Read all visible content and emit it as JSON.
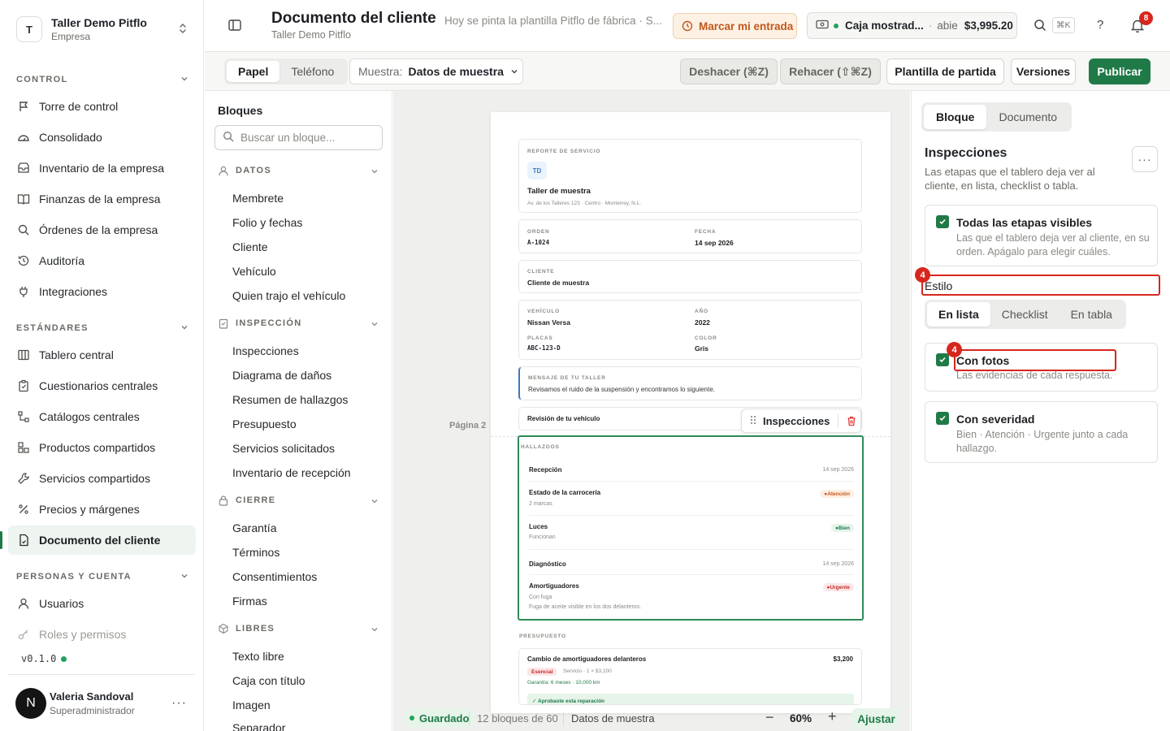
{
  "workspace": {
    "initial": "T",
    "name": "Taller Demo Pitflo",
    "role": "Empresa"
  },
  "nav": {
    "sections": [
      {
        "title": "CONTROL",
        "items": [
          {
            "label": "Torre de control",
            "icon": "tower-icon"
          },
          {
            "label": "Consolidado",
            "icon": "gauge-icon"
          },
          {
            "label": "Inventario de la empresa",
            "icon": "box-icon"
          },
          {
            "label": "Finanzas de la empresa",
            "icon": "book-icon"
          },
          {
            "label": "Órdenes de la empresa",
            "icon": "search-icon"
          },
          {
            "label": "Auditoría",
            "icon": "history-icon"
          },
          {
            "label": "Integraciones",
            "icon": "plug-icon"
          }
        ]
      },
      {
        "title": "ESTÁNDARES",
        "items": [
          {
            "label": "Tablero central",
            "icon": "board-icon"
          },
          {
            "label": "Cuestionarios centrales",
            "icon": "clipboard-icon"
          },
          {
            "label": "Catálogos centrales",
            "icon": "tree-icon"
          },
          {
            "label": "Productos compartidos",
            "icon": "products-icon"
          },
          {
            "label": "Servicios compartidos",
            "icon": "wrench-icon"
          },
          {
            "label": "Precios y márgenes",
            "icon": "percent-icon"
          },
          {
            "label": "Documento del cliente",
            "icon": "document-icon"
          }
        ]
      },
      {
        "title": "PERSONAS Y CUENTA",
        "items": [
          {
            "label": "Usuarios",
            "icon": "user-icon"
          },
          {
            "label": "Roles y permisos",
            "icon": "key-icon"
          }
        ]
      }
    ],
    "active": "Documento del cliente"
  },
  "version": "v0.1.0",
  "user": {
    "initial": "N",
    "name": "Valeria Sandoval",
    "role": "Superadministrador"
  },
  "header": {
    "title": "Documento del cliente",
    "description": "Hoy se pinta la plantilla Pitflo de fábrica · S...",
    "crumb": "Taller Demo Pitflo",
    "clock_in": "Marcar mi entrada",
    "cashbox": {
      "name": "Caja mostrad...",
      "status": "abie",
      "amount": "$3,995.20"
    },
    "shortcut": "⌘K",
    "help": "?",
    "notifications": "8"
  },
  "toolbar": {
    "views": [
      "Papel",
      "Teléfono"
    ],
    "active_view": "Papel",
    "sample_label": "Muestra:",
    "sample_value": "Datos de muestra",
    "undo": "Deshacer (⌘Z)",
    "redo": "Rehacer (⇧⌘Z)",
    "template": "Plantilla de partida",
    "versions": "Versiones",
    "publish": "Publicar"
  },
  "blocks": {
    "title": "Bloques",
    "search_placeholder": "Buscar un bloque...",
    "groups": [
      {
        "title": "DATOS",
        "icon": "person-icon",
        "items": [
          "Membrete",
          "Folio y fechas",
          "Cliente",
          "Vehículo",
          "Quien trajo el vehículo"
        ]
      },
      {
        "title": "INSPECCIÓN",
        "icon": "clipboard-icon",
        "items": [
          "Inspecciones",
          "Diagrama de daños",
          "Resumen de hallazgos",
          "Presupuesto",
          "Servicios solicitados",
          "Inventario de recepción"
        ]
      },
      {
        "title": "CIERRE",
        "icon": "lock-icon",
        "items": [
          "Garantía",
          "Términos",
          "Consentimientos",
          "Firmas"
        ]
      },
      {
        "title": "LIBRES",
        "icon": "cube-icon",
        "items": [
          "Texto libre",
          "Caja con título",
          "Imagen",
          "Separador"
        ]
      }
    ]
  },
  "document": {
    "header_label": "REPORTE DE SERVICIO",
    "logo_initials": "TD",
    "shop_name": "Taller de muestra",
    "shop_address": "Av. de los Talleres 123 · Centro · Monterrey, N.L.",
    "order_label": "ORDEN",
    "order": "A-1024",
    "date_label": "FECHA",
    "date": "14 sep 2026",
    "client_label": "CLIENTE",
    "client": "Cliente de muestra",
    "vehicle_label": "VEHÍCULO",
    "vehicle": "Nissan Versa",
    "year_label": "AÑO",
    "year": "2022",
    "plates_label": "PLACAS",
    "plates": "ABC-123-D",
    "color_label": "COLOR",
    "color": "Gris",
    "message_label": "MENSAJE DE TU TALLER",
    "message": "Revisamos el ruido de la suspensión y encontramos lo siguiente.",
    "review_title": "Revisión de tu vehículo",
    "page_label": "Página 2",
    "floating_label": "Inspecciones",
    "findings_label": "HALLAZGOS",
    "findings": [
      {
        "title": "Recepción",
        "sub": "",
        "date": "14 sep 2026",
        "badge": ""
      },
      {
        "title": "Estado de la carrocería",
        "sub": "2 marcas",
        "date": "",
        "badge": "Atención"
      },
      {
        "title": "Luces",
        "sub": "Funcionan",
        "date": "",
        "badge": "Bien"
      },
      {
        "title": "Diagnóstico",
        "sub": "",
        "date": "14 sep 2026",
        "badge": ""
      },
      {
        "title": "Amortiguadores",
        "sub": "Con fuga",
        "sub2": "Fuga de aceite visible en los dos delanteros.",
        "date": "",
        "badge": "Urgente"
      }
    ],
    "budget_label": "PRESUPUESTO",
    "budget_item": "Cambio de amortiguadores delanteros",
    "budget_amount": "$3,200",
    "budget_tag": "Esencial",
    "budget_meta": "Servicio · 1 × $3,200",
    "budget_warranty": "Garantía: 6 meses · 10,000 km",
    "budget_approved": "✓ Aprobaste esta reparación"
  },
  "footer": {
    "saved": "Guardado",
    "count": "12 bloques de 60",
    "sample": "Datos de muestra",
    "zoom": "60%",
    "fit": "Ajustar"
  },
  "inspector": {
    "tabs": [
      "Bloque",
      "Documento"
    ],
    "active_tab": "Bloque",
    "title": "Inspecciones",
    "description": "Las etapas que el tablero deja ver al cliente, en lista, checklist o tabla.",
    "all_stages_title": "Todas las etapas visibles",
    "all_stages_desc": "Las que el tablero deja ver al cliente, en su orden. Apágalo para elegir cuáles.",
    "style_label": "Estilo",
    "style_options": [
      "En lista",
      "Checklist",
      "En tabla"
    ],
    "active_style": "En lista",
    "photos_title": "Con fotos",
    "photos_desc": "Las evidencias de cada respuesta.",
    "severity_title": "Con severidad",
    "severity_desc": "Bien · Atención · Urgente junto a cada hallazgo.",
    "annotation_badge": "4"
  },
  "colors": {
    "brand": "#1f7a47",
    "accent_orange": "#c2571b",
    "alert_red": "#d7261e"
  }
}
